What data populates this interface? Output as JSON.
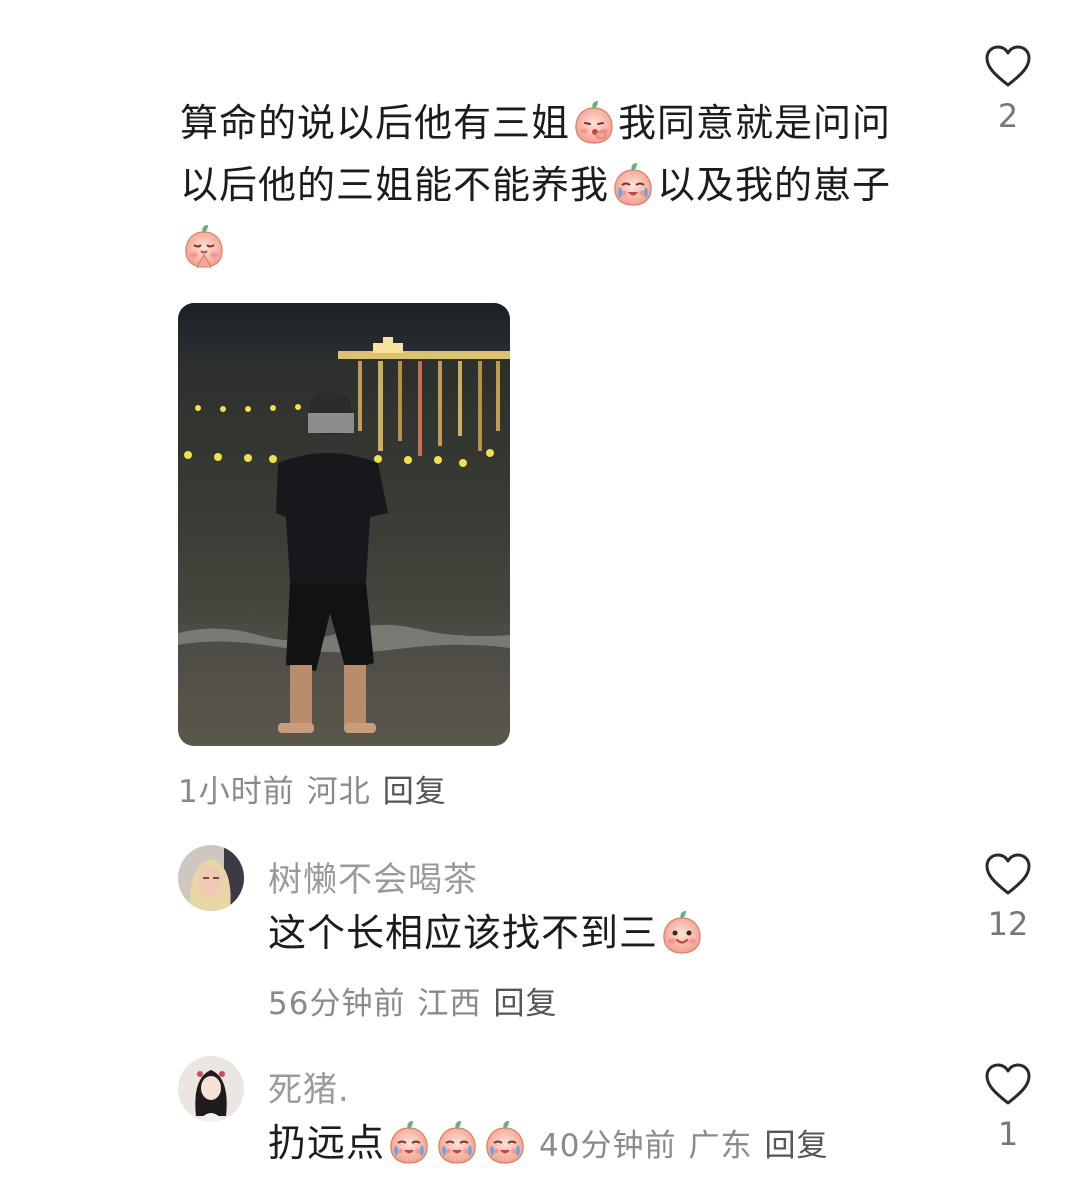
{
  "main_comment": {
    "text_1": "算命的说以后他有三姐",
    "text_2": "我同意就是问问以后他的三姐能不能养我",
    "text_3": "以及我的崽子",
    "emoji_1": "peach-thinking-emoji",
    "emoji_2": "peach-crying-emoji",
    "emoji_3": "peach-praying-emoji",
    "time": "1小时前",
    "location": "河北",
    "reply": "回复",
    "likes": "2"
  },
  "replies": [
    {
      "username": "树懒不会喝茶",
      "text": "这个长相应该找不到三",
      "emoji": "peach-smile-emoji",
      "time": "56分钟前",
      "location": "江西",
      "reply": "回复",
      "likes": "12"
    },
    {
      "username": "死猪.",
      "text": "扔远点",
      "emoji": "peach-crying-emoji",
      "time": "40分钟前",
      "location": "广东",
      "reply": "回复",
      "likes": "1"
    }
  ],
  "colors": {
    "text": "#1c1c1c",
    "meta": "#8a8a8a",
    "username": "#9a9a9a",
    "peach": "#f6b3a6",
    "leaf": "#5fb37a"
  }
}
